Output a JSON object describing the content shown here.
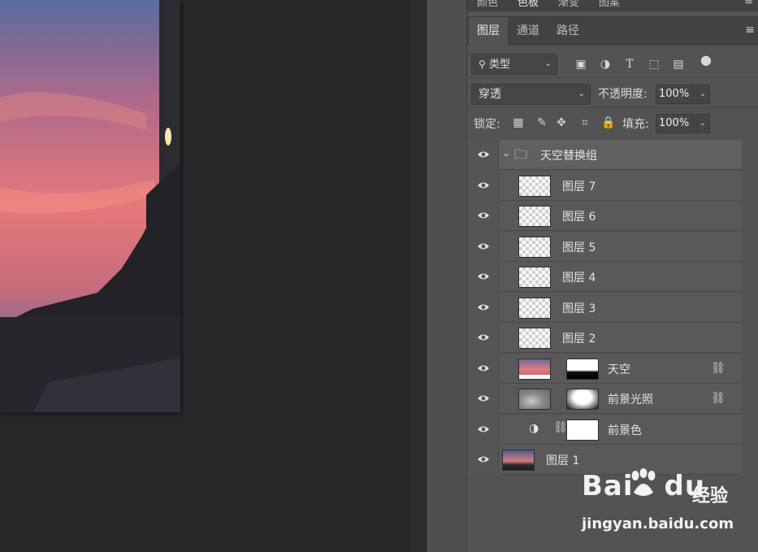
{
  "top_tabs": [
    "颜色",
    "色板",
    "渐变",
    "图案"
  ],
  "layer_panel": {
    "tabs": [
      {
        "label": "图层",
        "active": true
      },
      {
        "label": "通道",
        "active": false
      },
      {
        "label": "路径",
        "active": false
      }
    ],
    "filter": {
      "value": "类型",
      "icons": [
        "image-filter-icon",
        "adjustment-filter-icon",
        "type-filter-icon",
        "shape-filter-icon",
        "smart-object-filter-icon",
        "filter-toggle-icon"
      ]
    },
    "blend_mode": "穿透",
    "opacity_label": "不透明度:",
    "opacity_value": "100%",
    "lock_label": "锁定:",
    "fill_label": "填充:",
    "fill_value": "100%",
    "layers": [
      {
        "name": "天空替换组",
        "kind": "group"
      },
      {
        "name": "图层 7",
        "kind": "empty"
      },
      {
        "name": "图层 6",
        "kind": "empty"
      },
      {
        "name": "图层 5",
        "kind": "empty"
      },
      {
        "name": "图层 4",
        "kind": "empty"
      },
      {
        "name": "图层 3",
        "kind": "empty"
      },
      {
        "name": "图层 2",
        "kind": "empty"
      },
      {
        "name": "天空",
        "kind": "masked-image"
      },
      {
        "name": "前景光照",
        "kind": "masked-image"
      },
      {
        "name": "前景色",
        "kind": "adjustment"
      },
      {
        "name": "图层 1",
        "kind": "image"
      }
    ]
  },
  "watermark": {
    "brand": "Bai",
    "brand_suffix": "du",
    "product": "经验",
    "url": "jingyan.baidu.com"
  },
  "colors": {
    "panel_bg": "#535353",
    "canvas_bg": "#282828",
    "layer_row": "#595959"
  }
}
